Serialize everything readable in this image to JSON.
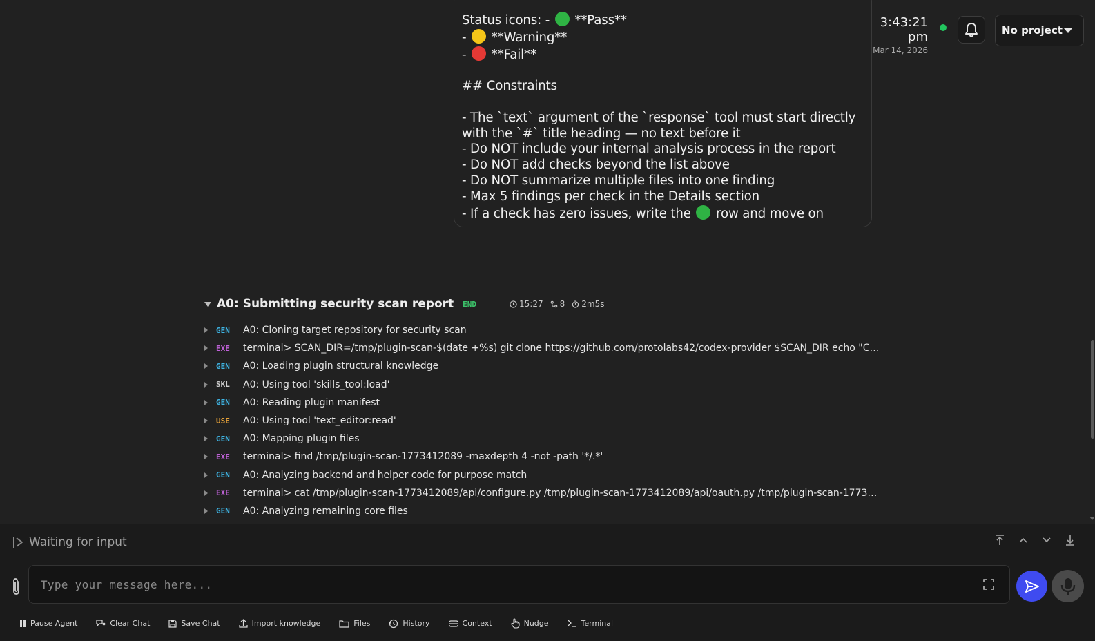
{
  "message": {
    "lines": [
      {
        "pre": "Status icons: - ",
        "emoji": "green",
        "post": " **Pass**"
      },
      {
        "pre": "- ",
        "emoji": "yellow",
        "post": " **Warning**"
      },
      {
        "pre": "- ",
        "emoji": "red",
        "post": " **Fail**"
      },
      {
        "blank": true
      },
      {
        "pre": "## Constraints"
      },
      {
        "blank": true
      },
      {
        "pre": "- The `text` argument of the `response` tool must start directly"
      },
      {
        "pre": "with the `#` title heading — no text before it"
      },
      {
        "pre": "- Do NOT include your internal analysis process in the report"
      },
      {
        "pre": "- Do NOT add checks beyond the list above"
      },
      {
        "pre": "- Do NOT summarize multiple files into one finding"
      },
      {
        "pre": "- Max 5 findings per check in the Details section"
      },
      {
        "pre": "- If a check has zero issues, write the ",
        "emoji": "green",
        "post": " row and move on"
      }
    ]
  },
  "header": {
    "time": "3:43:21 pm",
    "date": "Mar 14, 2026",
    "status_color": "#22c55e",
    "project_label": "No project"
  },
  "process": {
    "title": "A0: Submitting security scan report",
    "status": "END",
    "time": "15:27",
    "steps_count": "8",
    "duration": "2m5s",
    "steps": [
      {
        "type": "GEN",
        "color": "#3fb6e6",
        "text": "A0: Cloning target repository for security scan"
      },
      {
        "type": "EXE",
        "color": "#c062d8",
        "text": "terminal> SCAN_DIR=/tmp/plugin-scan-$(date +%s) git clone https://github.com/protolabs42/codex-provider $SCAN_DIR echo \"CLON..."
      },
      {
        "type": "GEN",
        "color": "#3fb6e6",
        "text": "A0: Loading plugin structural knowledge"
      },
      {
        "type": "SKL",
        "color": "#cfcfcf",
        "text": "A0: Using tool 'skills_tool:load'"
      },
      {
        "type": "GEN",
        "color": "#3fb6e6",
        "text": "A0: Reading plugin manifest"
      },
      {
        "type": "USE",
        "color": "#e8a33a",
        "text": "A0: Using tool 'text_editor:read'"
      },
      {
        "type": "GEN",
        "color": "#3fb6e6",
        "text": "A0: Mapping plugin files"
      },
      {
        "type": "EXE",
        "color": "#c062d8",
        "text": "terminal> find /tmp/plugin-scan-1773412089 -maxdepth 4 -not -path '*/.*'"
      },
      {
        "type": "GEN",
        "color": "#3fb6e6",
        "text": "A0: Analyzing backend and helper code for purpose match"
      },
      {
        "type": "EXE",
        "color": "#c062d8",
        "text": "terminal> cat /tmp/plugin-scan-1773412089/api/configure.py /tmp/plugin-scan-1773412089/api/oauth.py /tmp/plugin-scan-17734120..."
      },
      {
        "type": "GEN",
        "color": "#3fb6e6",
        "text": "A0: Analyzing remaining core files"
      }
    ]
  },
  "status_line": "Waiting for input",
  "input": {
    "placeholder": "Type your message here..."
  },
  "toolbar": {
    "pause": "Pause Agent",
    "clear": "Clear Chat",
    "save": "Save Chat",
    "import": "Import knowledge",
    "files": "Files",
    "history": "History",
    "context": "Context",
    "nudge": "Nudge",
    "terminal": "Terminal"
  },
  "colors": {
    "send_button": "#3f4bf0",
    "emoji_green": "#2fb344",
    "emoji_yellow": "#f5c518",
    "emoji_red": "#e53935"
  }
}
